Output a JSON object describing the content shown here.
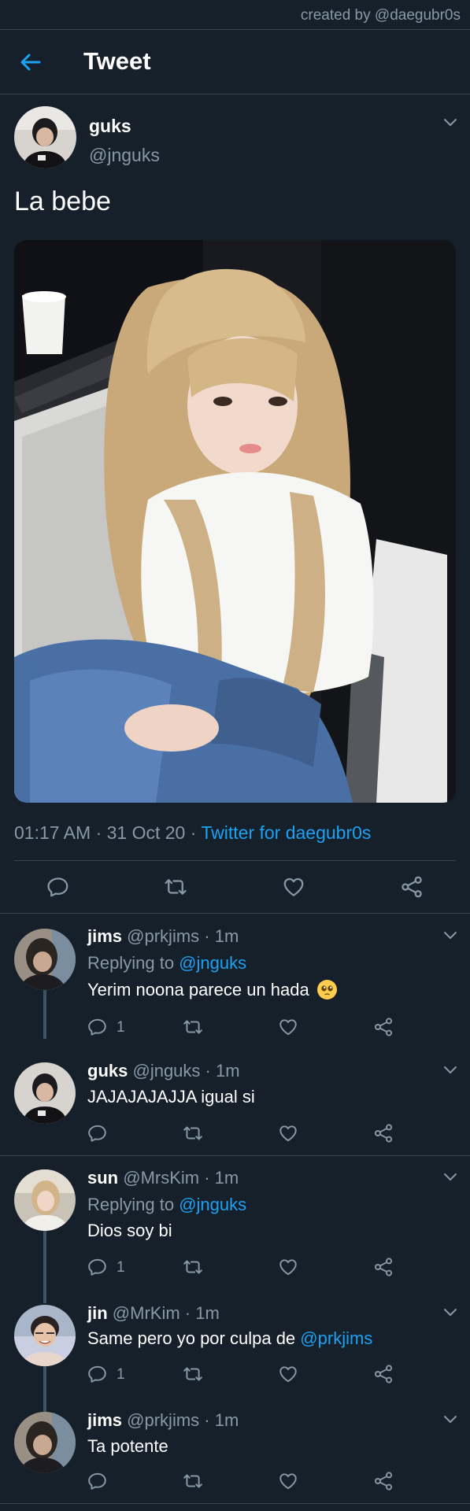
{
  "credit": "created by @daegubr0s",
  "header": {
    "title": "Tweet"
  },
  "tweet": {
    "name": "guks",
    "handle": "@jnguks",
    "text": "La bebe",
    "time": "01:17 AM · 31 Oct 20 · ",
    "source": "Twitter for daegubr0s"
  },
  "replies": [
    {
      "name": "jims",
      "handle": "@prkjims · 1m",
      "replying_label": "Replying to",
      "replying_to": "@jnguks",
      "text": "Yerim noona parece un hada",
      "reply_count": "1"
    },
    {
      "name": "guks",
      "handle": "@jnguks · 1m",
      "text": "JAJAJAJAJJA igual si"
    },
    {
      "name": "sun",
      "handle": "@MrsKim · 1m",
      "replying_label": "Replying to",
      "replying_to": "@jnguks",
      "text": "Dios soy bi",
      "reply_count": "1"
    },
    {
      "name": "jin",
      "handle": "@MrKim · 1m",
      "text": "Same pero yo por culpa de",
      "mention": "@prkjims",
      "reply_count": "1"
    },
    {
      "name": "jims",
      "handle": "@prkjims · 1m",
      "text": "Ta potente"
    }
  ],
  "colors": {
    "background": "#15202b",
    "accent": "#1da1f2",
    "muted": "#8899a6",
    "divider": "#38444d"
  },
  "icons": [
    "back-arrow-icon",
    "chevron-down-icon",
    "reply-icon",
    "retweet-icon",
    "like-icon",
    "share-icon",
    "pleading-face-emoji"
  ]
}
